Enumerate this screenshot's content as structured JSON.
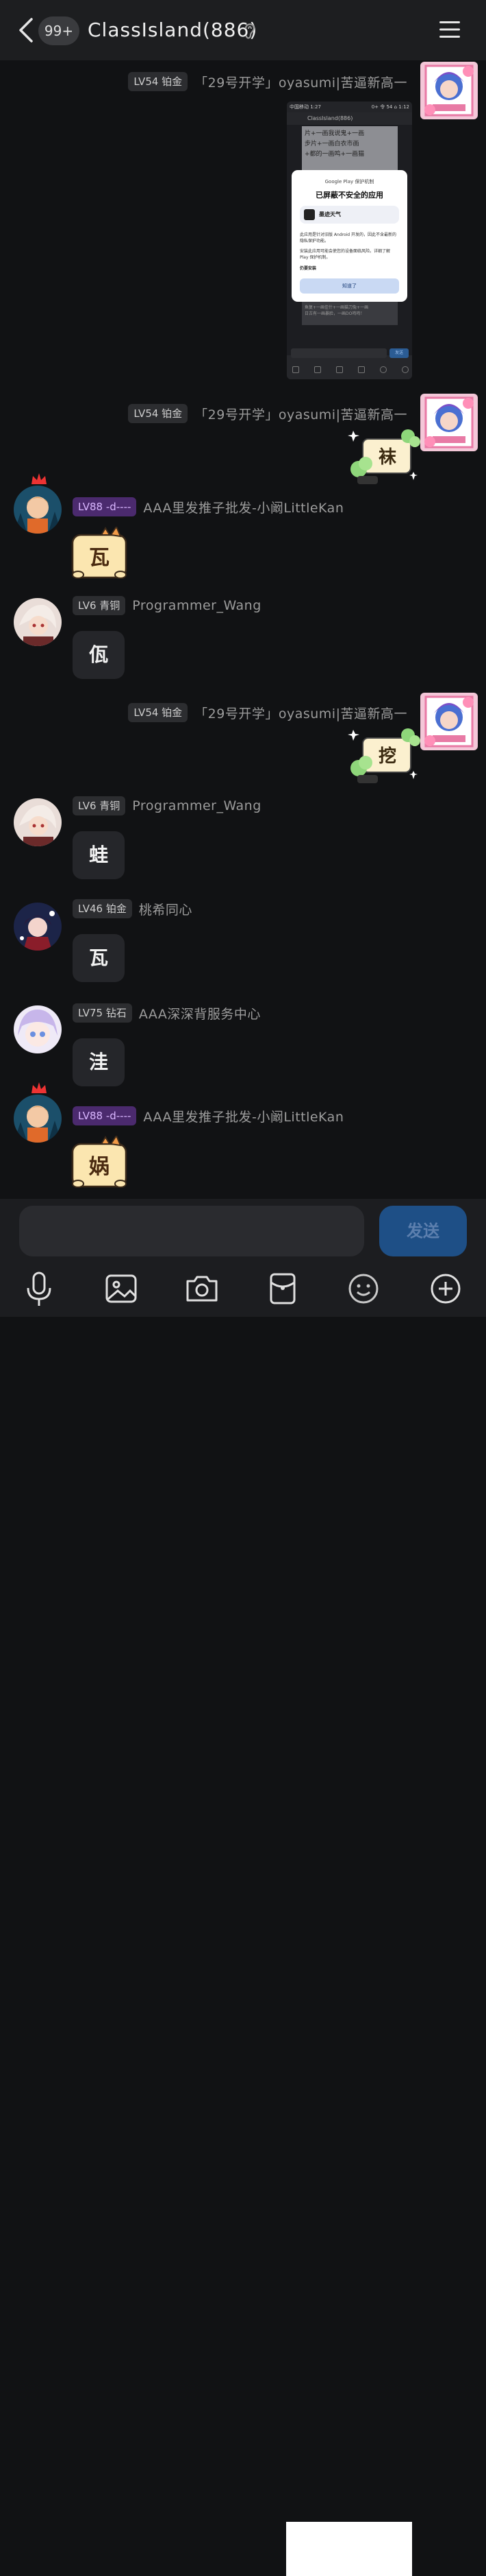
{
  "header": {
    "unread_badge": "99+",
    "title": "ClassIsland(886)"
  },
  "messages": [
    {
      "level": "LV54 铂金",
      "name": "「29号开学」oyasumi|苦逼新高一",
      "type": "image"
    },
    {
      "level": "LV54 铂金",
      "name": "「29号开学」oyasumi|苦逼新高一",
      "sticker_char": "袜"
    },
    {
      "level": "LV88 -d----",
      "name": "AAA里发推子批发-小阚LittleKan",
      "sticker_char": "瓦"
    },
    {
      "level": "LV6 青铜",
      "name": "Programmer_Wang",
      "text": "佤"
    },
    {
      "level": "LV54 铂金",
      "name": "「29号开学」oyasumi|苦逼新高一",
      "sticker_char": "挖"
    },
    {
      "level": "LV6 青铜",
      "name": "Programmer_Wang",
      "text": "蛙"
    },
    {
      "level": "LV46 铂金",
      "name": "桃希同心",
      "text": "瓦"
    },
    {
      "level": "LV75 钻石",
      "name": "AAA深深背服务中心",
      "text": "洼"
    },
    {
      "level": "LV88 -d----",
      "name": "AAA里发推子批发-小阚LittleKan",
      "sticker_char": "娲"
    }
  ],
  "screenshot": {
    "status_left": "中国移动 1:27",
    "status_right": "0+ 令 54 ⌂ 1:12",
    "chat_title": "ClassIsland(886)",
    "bg_text_1": "片+一画我说鬼+一画",
    "bg_text_2": "步片+一画白衣市画",
    "bg_text_3": "+都的一画鸣+一画猫",
    "dialog_header": "Google Play 保护机制",
    "dialog_title": "已屏蔽不安全的应用",
    "app_name": "墨迹天气",
    "body1": "此应用是针对旧版 Android 开发的，因此不含最新的隐私保护功能。",
    "body2": "安装此应用可能会使您的设备面临风险。详细了解 Play 保护机制。",
    "install_anyway": "仍要安装",
    "ok_button": "知道了",
    "bottom_text_1": "鱼复+一画佳什+一画猫刀兔+一画",
    "bottom_text_2": "日古有一画暴脸，一画DO鸣鸣！",
    "send_label": "发送"
  },
  "input": {
    "send": "发送"
  },
  "toolbar": {
    "icons": [
      "microphone-icon",
      "image-icon",
      "camera-icon",
      "red-packet-icon",
      "emoji-icon",
      "plus-icon"
    ]
  }
}
